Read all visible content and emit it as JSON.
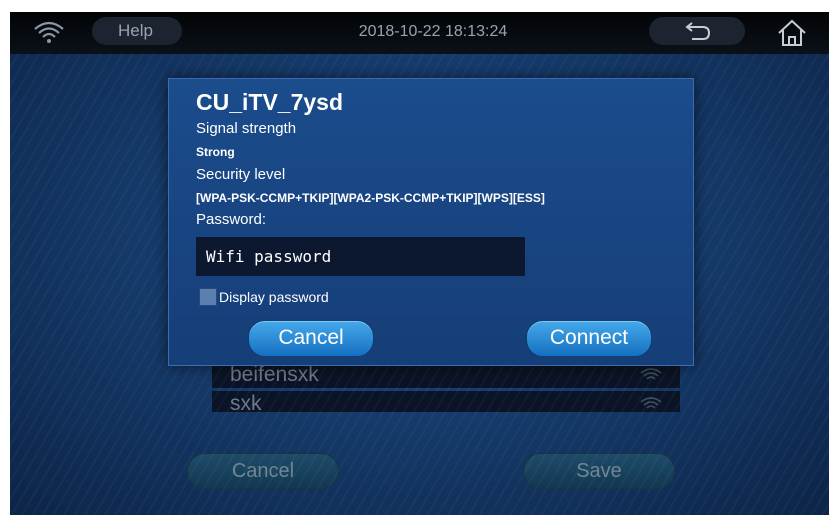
{
  "topbar": {
    "help_label": "Help",
    "datetime": "2018-10-22 18:13:24",
    "icons": [
      "wifi-icon",
      "back-arrow-icon",
      "home-icon"
    ]
  },
  "wifi_list": [
    {
      "ssid": "beifensxk"
    },
    {
      "ssid": "sxk"
    }
  ],
  "bottom_buttons": {
    "cancel_label": "Cancel",
    "save_label": "Save"
  },
  "dialog": {
    "network_name": "CU_iTV_7ysd",
    "signal_label": "Signal strength",
    "signal_value": "Strong",
    "security_label": "Security level",
    "security_value": "[WPA-PSK-CCMP+TKIP][WPA2-PSK-CCMP+TKIP][WPS][ESS]",
    "password_label": "Password:",
    "password_placeholder": "Wifi password",
    "display_password_label": "Display password",
    "cancel_label": "Cancel",
    "connect_label": "Connect"
  },
  "colors": {
    "dialog_bg": "#1b4c8c",
    "button_accent": "#2b8ad8",
    "input_bg": "#0c1730"
  }
}
